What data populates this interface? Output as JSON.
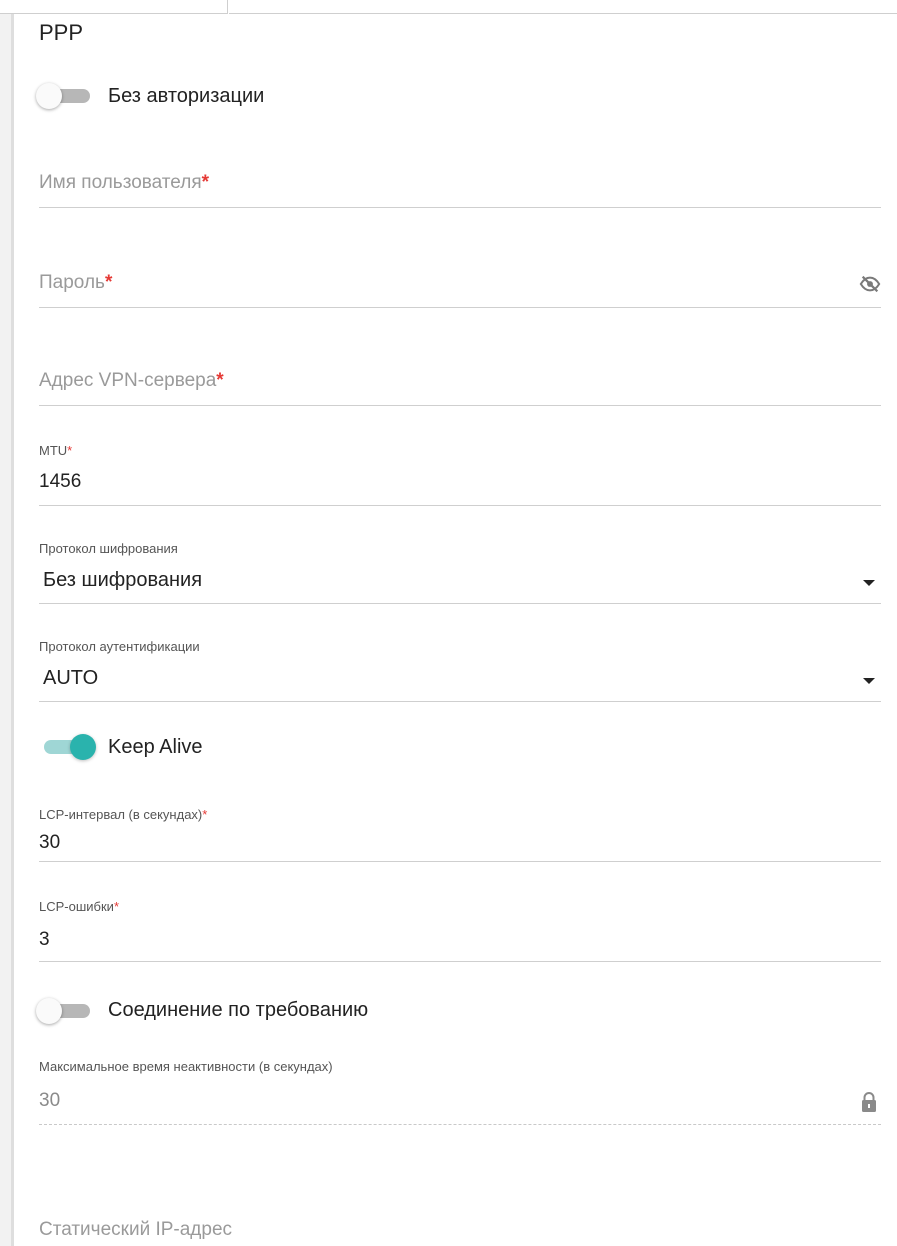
{
  "section": {
    "title": "PPP"
  },
  "toggles": {
    "no_auth": {
      "label": "Без авторизации",
      "state": "off"
    },
    "keep_alive": {
      "label": "Keep Alive",
      "state": "on"
    },
    "on_demand": {
      "label": "Соединение по требованию",
      "state": "off"
    }
  },
  "fields": {
    "username": {
      "placeholder": "Имя пользователя",
      "required_mark": "*"
    },
    "password": {
      "placeholder": "Пароль",
      "required_mark": "*",
      "icon": "eye-off-icon"
    },
    "vpn_server": {
      "placeholder": "Адрес VPN-сервера",
      "required_mark": "*"
    },
    "mtu": {
      "label": "MTU",
      "required_mark": "*",
      "value": "1456"
    },
    "encryption": {
      "label": "Протокол шифрования",
      "value": "Без шифрования"
    },
    "auth_protocol": {
      "label": "Протокол аутентификации",
      "value": "AUTO"
    },
    "lcp_interval": {
      "label": "LCP-интервал (в секундах)",
      "required_mark": "*",
      "value": "30"
    },
    "lcp_errors": {
      "label": "LCP-ошибки",
      "required_mark": "*",
      "value": "3"
    },
    "max_idle": {
      "label": "Максимальное время неактивности (в секундах)",
      "value": "30",
      "icon": "lock-icon"
    },
    "static_ip": {
      "placeholder": "Статический IP-адрес"
    }
  },
  "colors": {
    "accent": "#2ab3ad",
    "required": "#e53935"
  }
}
